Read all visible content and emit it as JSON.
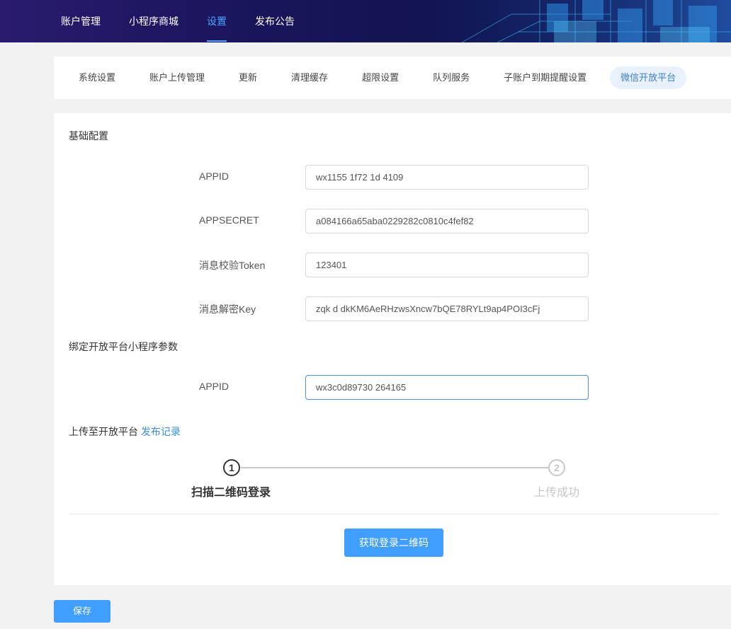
{
  "topnav": {
    "items": [
      {
        "label": "账户管理"
      },
      {
        "label": "小程序商城"
      },
      {
        "label": "设置",
        "active": true
      },
      {
        "label": "发布公告"
      }
    ],
    "active_color": "#4da3ff"
  },
  "subtabs": [
    {
      "label": "系统设置"
    },
    {
      "label": "账户上传管理"
    },
    {
      "label": "更新"
    },
    {
      "label": "清理缓存"
    },
    {
      "label": "超限设置"
    },
    {
      "label": "队列服务"
    },
    {
      "label": "子账户到期提醒设置"
    },
    {
      "label": "微信开放平台",
      "active": true
    }
  ],
  "basic": {
    "title": "基础配置",
    "fields": [
      {
        "label": "APPID",
        "value": "wx1155 1f72 1d 4109"
      },
      {
        "label": "APPSECRET",
        "value": "a084166a65aba0229282c0810c4fef82"
      },
      {
        "label": "消息校验Token",
        "value": "123401"
      },
      {
        "label": "消息解密Key",
        "value": "zqk d dkKM6AeRHzwsXncw7bQE78RYLt9ap4POI3cFj"
      }
    ]
  },
  "bind": {
    "title": "绑定开放平台小程序参数",
    "field": {
      "label": "APPID",
      "value": "wx3c0d89730 264165"
    }
  },
  "upload": {
    "title": "上传至开放平台",
    "link": "发布记录",
    "steps": [
      {
        "num": "1",
        "title": "扫描二维码登录",
        "active": true
      },
      {
        "num": "2",
        "title": "上传成功",
        "active": false
      }
    ],
    "qr_button": "获取登录二维码"
  },
  "save_button": "保存",
  "colors": {
    "primary": "#409eff",
    "tab_active_bg": "#e8f1fc",
    "link": "#3a8ee6"
  }
}
